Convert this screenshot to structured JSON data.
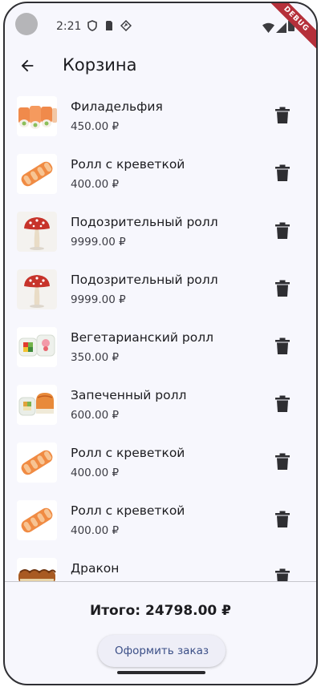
{
  "status_bar": {
    "time": "2:21",
    "icons": [
      "shield-icon",
      "sim-card-icon",
      "location-icon",
      "wifi-icon",
      "signal-icon",
      "battery-icon"
    ]
  },
  "debug_banner": "DEBUG",
  "app_bar": {
    "back_icon": "arrow-back-icon",
    "title": "Корзина"
  },
  "cart": {
    "items": [
      {
        "name": "Филадельфия",
        "price": "450.00 ₽",
        "image": "philadelphia-roll"
      },
      {
        "name": "Ролл с креветкой",
        "price": "400.00 ₽",
        "image": "shrimp-roll"
      },
      {
        "name": "Подозрительный ролл",
        "price": "9999.00 ₽",
        "image": "mushroom"
      },
      {
        "name": "Подозрительный ролл",
        "price": "9999.00 ₽",
        "image": "mushroom"
      },
      {
        "name": "Вегетарианский ролл",
        "price": "350.00 ₽",
        "image": "vegetarian-roll"
      },
      {
        "name": "Запеченный ролл",
        "price": "600.00 ₽",
        "image": "baked-roll"
      },
      {
        "name": "Ролл с креветкой",
        "price": "400.00 ₽",
        "image": "shrimp-roll"
      },
      {
        "name": "Ролл с креветкой",
        "price": "400.00 ₽",
        "image": "shrimp-roll"
      },
      {
        "name": "Дракон",
        "price": "",
        "image": "dragon-roll"
      }
    ],
    "delete_icon": "trash-icon"
  },
  "summary": {
    "total": "Итого: 24798.00 ₽"
  },
  "checkout": {
    "label": "Оформить заказ"
  },
  "colors": {
    "background": "#f7f7fd",
    "button_bg": "#eeeef7",
    "button_text": "#3b4f87",
    "debug_ribbon": "#b5303a"
  }
}
